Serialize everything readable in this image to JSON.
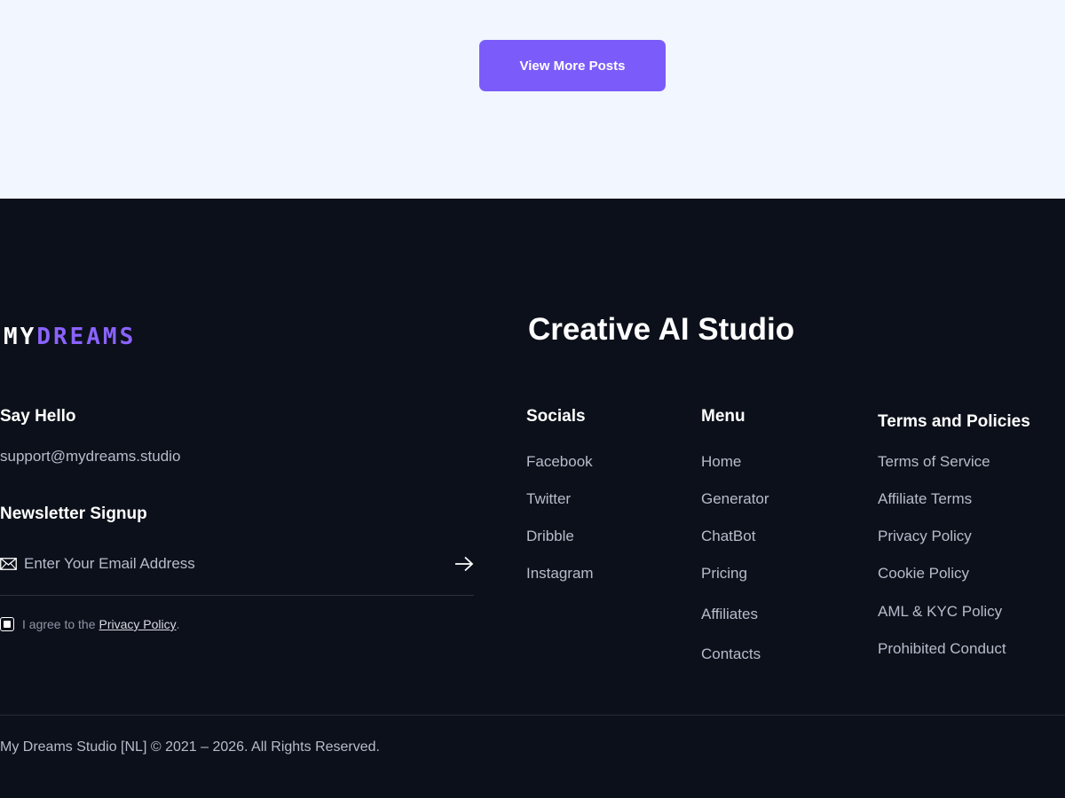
{
  "top": {
    "view_more_label": "View More Posts"
  },
  "footer": {
    "logo": {
      "part1": "MY",
      "part2": "DREAMS"
    },
    "title": "Creative AI Studio",
    "say_hello": {
      "heading": "Say Hello",
      "email": "support@mydreams.studio"
    },
    "newsletter": {
      "heading": "Newsletter Signup",
      "placeholder": "Enter Your Email Address",
      "agree_prefix": "I agree to the",
      "agree_link": "Privacy Policy",
      "agree_suffix": "."
    },
    "socials": {
      "heading": "Socials",
      "items": [
        "Facebook",
        "Twitter",
        "Dribble",
        "Instagram"
      ]
    },
    "menu": {
      "heading": "Menu",
      "items": [
        "Home",
        "Generator",
        "ChatBot",
        "Pricing",
        "Affiliates",
        "Contacts"
      ]
    },
    "terms": {
      "heading": "Terms and Policies",
      "items": [
        "Terms of Service",
        "Affiliate Terms",
        "Privacy Policy",
        "Cookie Policy",
        "AML & KYC Policy",
        "Prohibited Conduct"
      ]
    },
    "copyright": "My Dreams Studio [NL] © 2021 – 2026. All Rights Reserved."
  },
  "colors": {
    "accent": "#7b5cfa",
    "logo_accent": "#8a63ff",
    "footer_bg": "#0c101a",
    "top_bg": "#f1f6ff"
  },
  "icons": {
    "mail": "mail-icon",
    "arrow": "arrow-right-icon"
  }
}
